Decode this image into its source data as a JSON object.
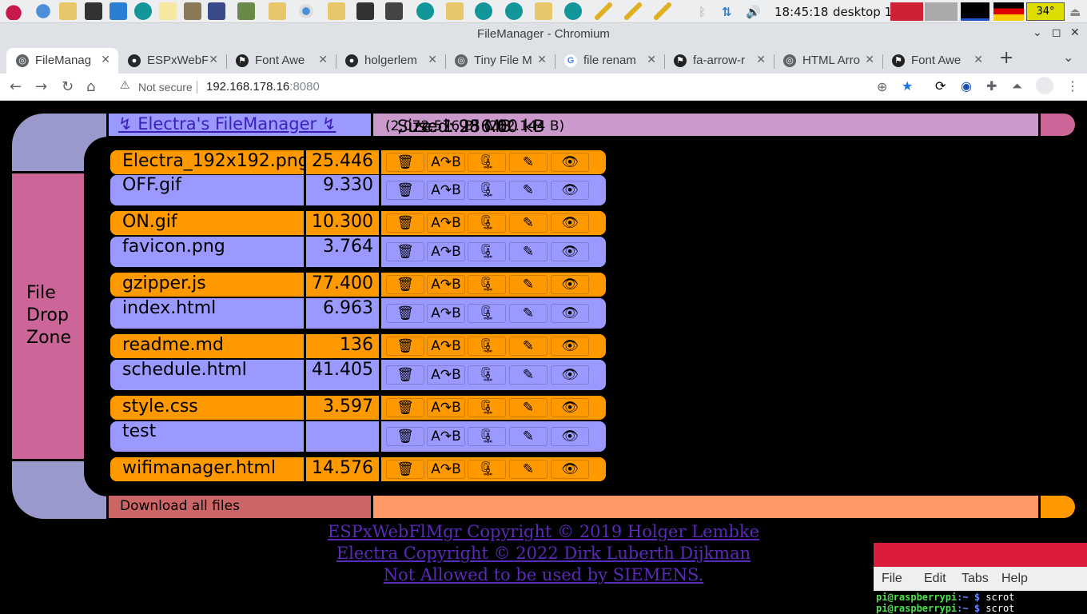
{
  "taskbar": {
    "clock": "18:45:18",
    "desktop_label": "desktop 1",
    "temperature": "34°"
  },
  "window": {
    "title": "FileManager - Chromium",
    "minimize": "⌄",
    "maximize": "◻",
    "close": "✕"
  },
  "tabs": [
    {
      "label": "FileManag",
      "active": true
    },
    {
      "label": "ESPxWebFl",
      "active": false
    },
    {
      "label": "Font Awe",
      "active": false
    },
    {
      "label": "holgerlem",
      "active": false
    },
    {
      "label": "Tiny File M",
      "active": false
    },
    {
      "label": "file renam",
      "active": false
    },
    {
      "label": "fa-arrow-r",
      "active": false
    },
    {
      "label": "HTML Arro",
      "active": false
    },
    {
      "label": "Font Awe",
      "active": false
    }
  ],
  "toolbar": {
    "security_label": "Not secure",
    "url_host": "192.168.178.16",
    "url_port": ":8080"
  },
  "page": {
    "title_link": "↯ Electra's FileManager ↯",
    "size_label": "Size: 1.98 MB",
    "size_bytes": "(2.072.576 B)",
    "used_label": ", used: 256.00 kB",
    "used_bytes": "(262.144 B)",
    "drop_zone": "File Drop Zone",
    "download_all": "Download all files",
    "action_labels": {
      "delete": "🗑",
      "rename": "A↷B",
      "zip": "🗜",
      "edit": "✎",
      "view": "👁"
    },
    "files": [
      {
        "name": "Electra_192x192.png",
        "size": "25.446"
      },
      {
        "name": "OFF.gif",
        "size": "9.330"
      },
      {
        "name": "ON.gif",
        "size": "10.300"
      },
      {
        "name": "favicon.png",
        "size": "3.764"
      },
      {
        "name": "gzipper.js",
        "size": "77.400"
      },
      {
        "name": "index.html",
        "size": "6.963"
      },
      {
        "name": "readme.md",
        "size": "136"
      },
      {
        "name": "schedule.html",
        "size": "41.405"
      },
      {
        "name": "style.css",
        "size": "3.597"
      },
      {
        "name": "test",
        "size": ""
      },
      {
        "name": "wifimanager.html",
        "size": "14.576"
      }
    ],
    "credits": [
      "ESPxWebFlMgr Copyright © 2019 Holger Lembke",
      "Electra Copyright © 2022 Dirk Luberth Dijkman",
      "Not Allowed to be used by SIEMENS."
    ]
  },
  "terminal": {
    "menu": [
      "File",
      "Edit",
      "Tabs",
      "Help"
    ],
    "lines": [
      {
        "user": "pi@raspberrypi",
        "path": ":~ $",
        "cmd": " scrot"
      },
      {
        "user": "pi@raspberrypi",
        "path": ":~ $",
        "cmd": " scrot"
      }
    ]
  },
  "colors": {
    "lcars_purple": "#9999cc",
    "lcars_pink": "#cc6699",
    "lcars_orange": "#ff9900",
    "lcars_blue": "#9999ff",
    "lcars_salmon": "#ff9966",
    "terminal_title": "#dc1c3c"
  }
}
